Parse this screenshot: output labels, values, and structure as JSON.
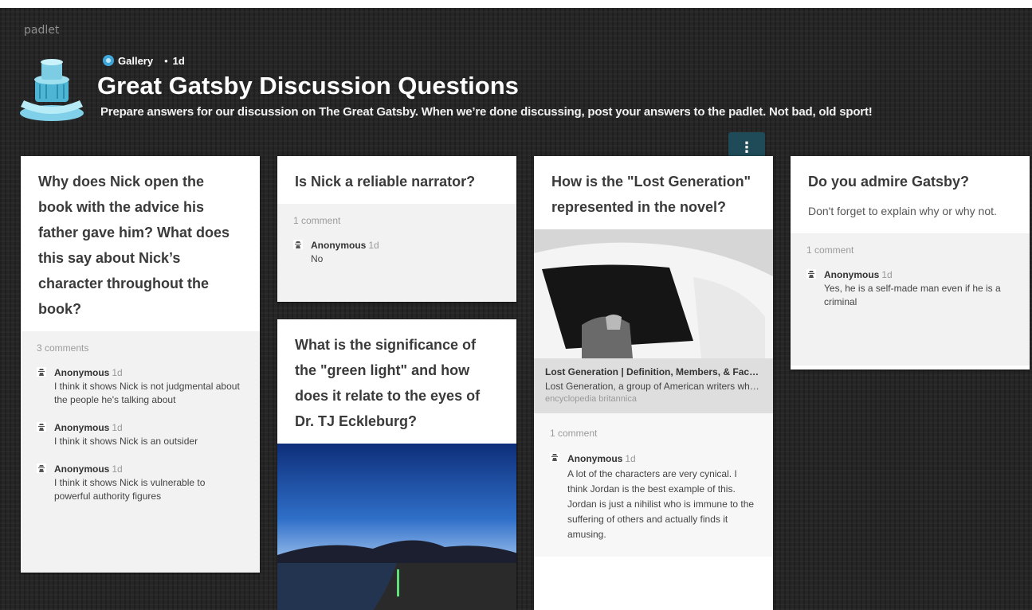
{
  "app": {
    "brand": "padlet"
  },
  "header": {
    "gallery_label": "Gallery",
    "age": "1d",
    "title": "Great Gatsby Discussion Questions",
    "subtitle": "Prepare answers for our discussion on The Great Gatsby. When we’re done discussing, post your answers to the padlet. Not bad, old sport!"
  },
  "colors": {
    "background": "#262626",
    "menu_button": "#1f4a57"
  },
  "posts": {
    "nick_advice": {
      "question": "Why does Nick open the book with the advice his father gave him? What does this say about Nick’s character throughout the book?",
      "comment_count": "3 comments",
      "comments": [
        {
          "author": "Anonymous",
          "time": "1d",
          "text": "I think it shows Nick is not judgmental about the people he's talking about"
        },
        {
          "author": "Anonymous",
          "time": "1d",
          "text": "I think it shows Nick is an outsider"
        },
        {
          "author": "Anonymous",
          "time": "1d",
          "text": "I think it shows Nick is vulnerable to powerful authority figures"
        }
      ]
    },
    "reliable": {
      "question": "Is Nick a reliable narrator?",
      "comment_count": "1 comment",
      "comments": [
        {
          "author": "Anonymous",
          "time": "1d",
          "text": "No"
        }
      ]
    },
    "green_light": {
      "question": "What is the significance of the \"green light\" and how does it relate to the eyes of Dr. TJ Eckleburg?",
      "image_icon": "lake-sunset-photo"
    },
    "lost_gen": {
      "question": "How is the \"Lost Generation\" represented in the novel?",
      "image_icon": "vintage-car-photo",
      "link": {
        "title": "Lost Generation | Definition, Members, & Facts | Britannica",
        "description": "Lost Generation, a group of American writers who came of age during World War I",
        "source": "encyclopedia britannica"
      },
      "comment_count": "1 comment",
      "comments": [
        {
          "author": "Anonymous",
          "time": "1d",
          "text": "A lot of the characters are very cynical. I think Jordan is the best example of this. Jordan is just a nihilist who is immune to the suffering of others and actually finds it amusing."
        }
      ]
    },
    "admire": {
      "question": "Do you admire Gatsby?",
      "body": "Don't forget to explain why or why not.",
      "comment_count": "1 comment",
      "comments": [
        {
          "author": "Anonymous",
          "time": "1d",
          "text": "Yes, he is a self-made man even if he is a criminal"
        }
      ]
    }
  }
}
